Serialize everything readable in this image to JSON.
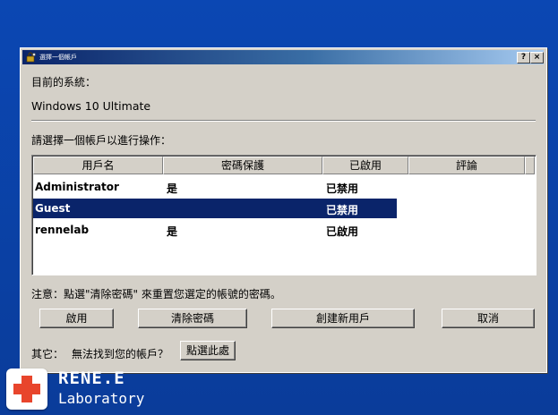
{
  "window": {
    "title": "選擇一個帳戶",
    "help_button": "?",
    "close_button": "×"
  },
  "system": {
    "label": "目前的系統：",
    "value": "Windows 10 Ultimate"
  },
  "prompt": "請選擇一個帳戶以進行操作：",
  "table": {
    "headers": [
      "用戶名",
      "密碼保護",
      "已啟用",
      "評論"
    ],
    "rows": [
      {
        "user": "Administrator",
        "password": "是",
        "enabled": "已禁用",
        "comment": ""
      },
      {
        "user": "Guest",
        "password": "",
        "enabled": "已禁用",
        "comment": "",
        "selected": true
      },
      {
        "user": "rennelab",
        "password": "是",
        "enabled": "已啟用",
        "comment": ""
      }
    ]
  },
  "note": "注意：點選\"清除密碼\" 來重置您選定的帳號的密碼。",
  "buttons": {
    "enable": "啟用",
    "clear_password": "清除密碼",
    "create_user": "創建新用戶",
    "cancel": "取消"
  },
  "other": {
    "label": "其它：",
    "question": "無法找到您的帳戶？",
    "button": "點選此處"
  },
  "branding": {
    "line1": "RENE.E",
    "line2": "Laboratory"
  },
  "colors": {
    "desktop": "#0a3fa0",
    "dialog": "#d4d0c8",
    "selection": "#0a246a",
    "logo_accent": "#e8452c"
  }
}
